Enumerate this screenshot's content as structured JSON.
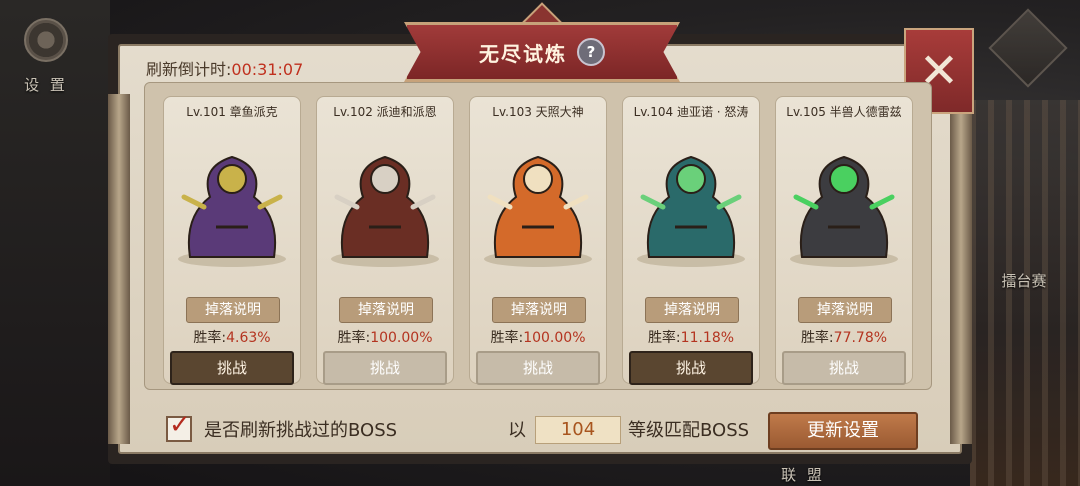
{
  "side": {
    "settings_label": "设 置",
    "arena_label": "擂台赛",
    "alliance_label": "联 盟"
  },
  "modal": {
    "title": "无尽试炼",
    "help_glyph": "?",
    "close_glyph": "✕",
    "countdown_label": "刷新倒计时:",
    "countdown_value": "00:31:07"
  },
  "bosses": [
    {
      "name": "Lv.101 章鱼派克",
      "drop_label": "掉落说明",
      "winrate_label": "胜率:",
      "winrate": "4.63%",
      "challenge": "挑战",
      "enabled": true,
      "color": "#5a3a78",
      "accent": "#c9b24a"
    },
    {
      "name": "Lv.102 派迪和派恩",
      "drop_label": "掉落说明",
      "winrate_label": "胜率:",
      "winrate": "100.00%",
      "challenge": "挑战",
      "enabled": false,
      "color": "#6a2e24",
      "accent": "#d8d0c4"
    },
    {
      "name": "Lv.103 天照大神",
      "drop_label": "掉落说明",
      "winrate_label": "胜率:",
      "winrate": "100.00%",
      "challenge": "挑战",
      "enabled": false,
      "color": "#d46a2a",
      "accent": "#f0e0c0"
    },
    {
      "name": "Lv.104 迪亚诺 · 怒涛",
      "drop_label": "掉落说明",
      "winrate_label": "胜率:",
      "winrate": "11.18%",
      "challenge": "挑战",
      "enabled": true,
      "color": "#2a6a6a",
      "accent": "#6ad07a"
    },
    {
      "name": "Lv.105 半兽人德雷兹",
      "drop_label": "掉落说明",
      "winrate_label": "胜率:",
      "winrate": "77.78%",
      "challenge": "挑战",
      "enabled": false,
      "color": "#3c3c40",
      "accent": "#4ad060"
    }
  ],
  "footer": {
    "refresh_checkbox_label": "是否刷新挑战过的BOSS",
    "refresh_checked": true,
    "level_prefix": "以",
    "level_value": "104",
    "level_suffix": "等级匹配BOSS",
    "update_button": "更新设置"
  }
}
